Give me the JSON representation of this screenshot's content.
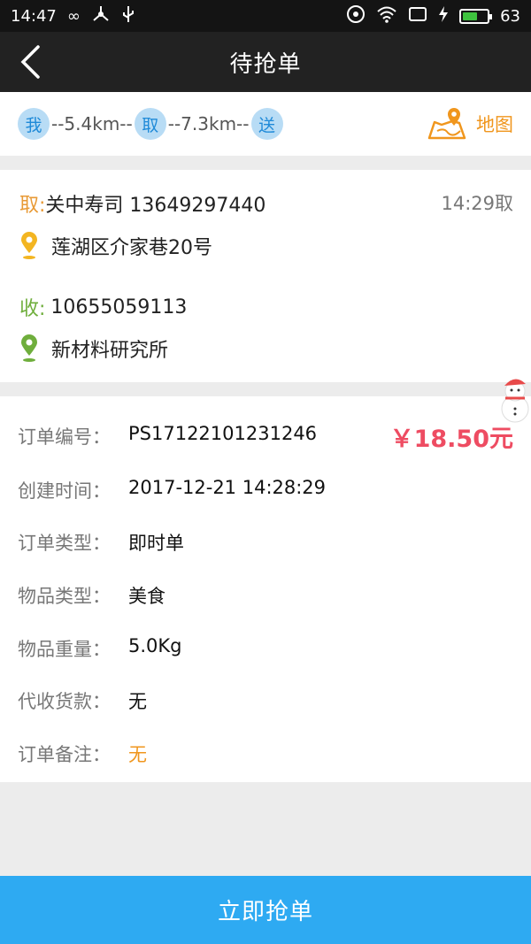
{
  "status_bar": {
    "time": "14:47",
    "battery_level": "63",
    "battery_fraction": 0.63
  },
  "nav": {
    "title": "待抢单"
  },
  "route": {
    "me_label": "我",
    "dist1": "--5.4km--",
    "pick_label": "取",
    "dist2": "--7.3km--",
    "deliver_label": "送",
    "map_label": "地图"
  },
  "pickup": {
    "prefix": "取:",
    "name_phone": "关中寿司 13649297440",
    "time": "14:29取",
    "address": "莲湖区介家巷20号"
  },
  "receive": {
    "prefix": "收:",
    "phone": "10655059113",
    "address": "新材料研究所"
  },
  "details": {
    "price": "￥18.50元",
    "rows": [
      {
        "label": "订单编号：",
        "value": "PS17122101231246"
      },
      {
        "label": "创建时间：",
        "value": "2017-12-21 14:28:29"
      },
      {
        "label": "订单类型：",
        "value": "即时单"
      },
      {
        "label": "物品类型：",
        "value": "美食"
      },
      {
        "label": "物品重量：",
        "value": "5.0Kg"
      },
      {
        "label": "代收货款：",
        "value": "无"
      },
      {
        "label": "订单备注：",
        "value": "无"
      }
    ]
  },
  "action": {
    "grab_label": "立即抢单"
  },
  "colors": {
    "accent_blue": "#2eaaf2",
    "orange": "#f0961d",
    "price_red": "#ee4c62",
    "green": "#6fae3c"
  }
}
